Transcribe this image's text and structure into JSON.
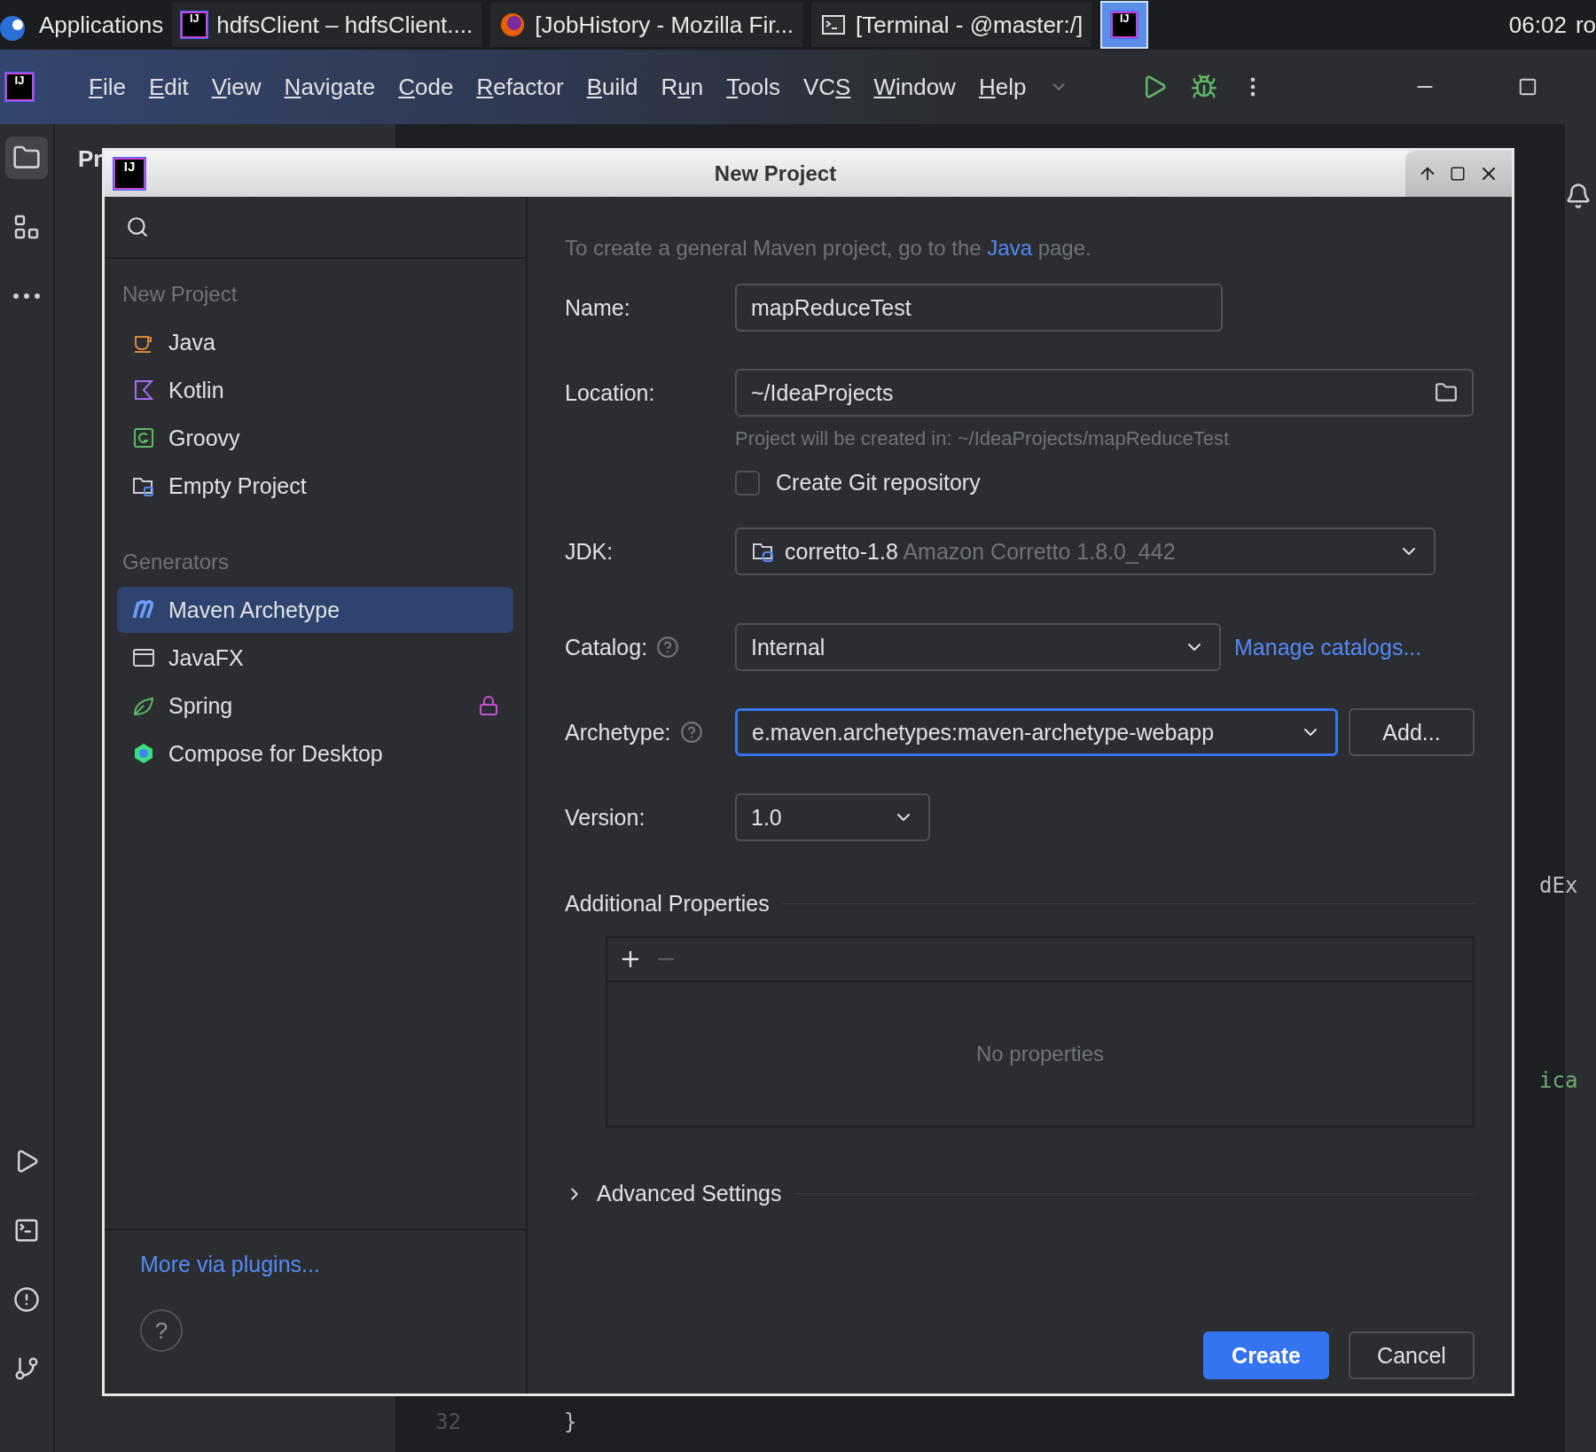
{
  "taskbar": {
    "apps_label": "Applications",
    "windows": [
      {
        "kind": "idea",
        "logo": "IJ",
        "label": "hdfsClient – hdfsClient....",
        "selected": false
      },
      {
        "kind": "firefox",
        "label": "[JobHistory - Mozilla Fir...",
        "selected": false
      },
      {
        "kind": "terminal",
        "label": "[Terminal - @master:/]",
        "selected": false
      },
      {
        "kind": "idea",
        "logo": "IJ",
        "selected": true
      }
    ],
    "clock": "06:02",
    "user": "ro"
  },
  "menubar": {
    "logo": "IJ",
    "menus": [
      {
        "mnemonic": "F",
        "after": "ile"
      },
      {
        "mnemonic": "E",
        "after": "dit"
      },
      {
        "mnemonic": "V",
        "after": "iew"
      },
      {
        "mnemonic": "N",
        "after": "avigate"
      },
      {
        "mnemonic": "C",
        "after": "ode"
      },
      {
        "mnemonic": "R",
        "after": "efactor"
      },
      {
        "mnemonic": "B",
        "after": "uild"
      },
      {
        "before": "R",
        "mnemonic": "u",
        "after": "n"
      },
      {
        "mnemonic": "T",
        "after": "ools"
      },
      {
        "before": "VC",
        "mnemonic": "S"
      },
      {
        "mnemonic": "W",
        "after": "indow"
      },
      {
        "mnemonic": "H",
        "after": "elp"
      }
    ]
  },
  "ide": {
    "project_title": "Pr",
    "editor_texts": [
      "dEx",
      "ica"
    ],
    "line_number": "32",
    "code": "}"
  },
  "dialog": {
    "title": "New Project",
    "logo": "IJ",
    "sidebar": {
      "sections": [
        {
          "heading": "New Project",
          "items": [
            {
              "label": "Java",
              "kind": "java",
              "selected": false
            },
            {
              "label": "Kotlin",
              "kind": "kotlin",
              "selected": false
            },
            {
              "label": "Groovy",
              "kind": "groovy",
              "selected": false
            },
            {
              "label": "Empty Project",
              "kind": "empty",
              "selected": false
            }
          ]
        },
        {
          "heading": "Generators",
          "items": [
            {
              "label": "Maven Archetype",
              "kind": "maven",
              "selected": true
            },
            {
              "label": "JavaFX",
              "kind": "javafx",
              "selected": false
            },
            {
              "label": "Spring",
              "kind": "spring",
              "selected": false,
              "locked": true
            },
            {
              "label": "Compose for Desktop",
              "kind": "compose",
              "selected": false
            }
          ]
        }
      ],
      "more_link": "More via plugins...",
      "help": "?"
    },
    "hint": {
      "before": "To create a general Maven project, go to the ",
      "link": "Java",
      "after": " page."
    },
    "name": {
      "label": "Name:",
      "value": "mapReduceTest"
    },
    "location": {
      "label": "Location:",
      "value": "~/IdeaProjects",
      "note": "Project will be created in: ~/IdeaProjects/mapReduceTest"
    },
    "git": {
      "label": "Create Git repository",
      "checked": false
    },
    "jdk": {
      "label": "JDK:",
      "value": "corretto-1.8",
      "detail": "Amazon Corretto 1.8.0_442"
    },
    "catalog": {
      "label": "Catalog:",
      "value": "Internal",
      "link": "Manage catalogs..."
    },
    "archetype": {
      "label": "Archetype:",
      "value": "e.maven.archetypes:maven-archetype-webapp",
      "focused": true,
      "button": "Add..."
    },
    "version": {
      "label": "Version:",
      "value": "1.0"
    },
    "properties": {
      "heading": "Additional Properties",
      "empty": "No properties"
    },
    "advanced": {
      "label": "Advanced Settings",
      "expanded": false
    },
    "buttons": [
      {
        "label": "Create",
        "primary": true
      },
      {
        "label": "Cancel",
        "primary": false
      }
    ]
  }
}
